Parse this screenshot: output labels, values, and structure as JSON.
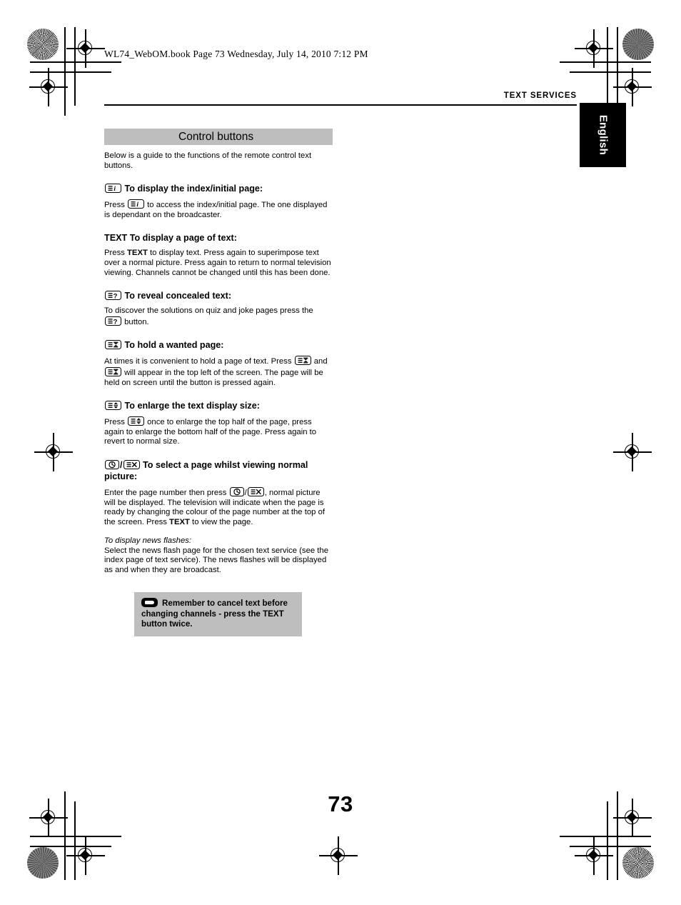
{
  "page": {
    "filename_line": "WL74_WebOM.book  Page 73  Wednesday, July 14, 2010  7:12 PM",
    "running_head": "TEXT SERVICES",
    "language_tab": "English",
    "page_number": "73"
  },
  "section": {
    "title": "Control buttons",
    "intro": "Below is a guide to the functions of the remote control text buttons."
  },
  "entries": [
    {
      "icon": "index-key-icon",
      "heading": "To display the index/initial page:",
      "body_before": "Press ",
      "body_after": " to access the index/initial page. The one displayed is dependant on the broadcaster."
    },
    {
      "icon": "text-key-icon",
      "heading_prefix": "TEXT",
      "heading": "To display a page of text:",
      "body_before": "Press ",
      "body_keyword": "TEXT",
      "body_after": " to display text. Press again to superimpose text over a normal picture. Press again to return to normal television viewing. Channels cannot be changed until this has been done."
    },
    {
      "icon": "reveal-key-icon",
      "heading": "To reveal concealed text:",
      "body_before": "To discover the solutions on quiz and joke pages press the ",
      "body_after": " button."
    },
    {
      "icon": "hold-key-icon",
      "heading": "To hold a wanted page:",
      "body_before": "At times it is convenient to hold a page of text. Press ",
      "body_middle": " and ",
      "body_after": " will appear in the top left of the screen. The page will be held on screen until the button is pressed again."
    },
    {
      "icon": "enlarge-key-icon",
      "heading": "To enlarge the text display size:",
      "body_before": "Press ",
      "body_after": " once to enlarge the top half of the page, press again to enlarge the bottom half of the page. Press again to revert to normal size."
    },
    {
      "icon": "timer-key-icon",
      "icon2": "cancel-key-icon",
      "heading": "To select a page whilst viewing normal picture:",
      "body_before": "Enter the page number then press ",
      "body_middle": "/",
      "body_after": ", normal picture will be displayed. The television will indicate when the page is ready by changing the colour of the page number at the top of the screen. Press ",
      "body_keyword": "TEXT",
      "body_end": " to view the page."
    }
  ],
  "news_flash": {
    "lead": "To display news flashes:",
    "body": "Select the news flash page for the chosen text service (see the index page of text service). The news flashes will be displayed as and when they are broadcast."
  },
  "note": {
    "icon": "remember-hand-icon",
    "text": "Remember to cancel text before changing channels - press the TEXT button twice."
  },
  "colors": {
    "bar_gray": "#bebebe",
    "tab_black": "#000000",
    "text_black": "#000000"
  }
}
